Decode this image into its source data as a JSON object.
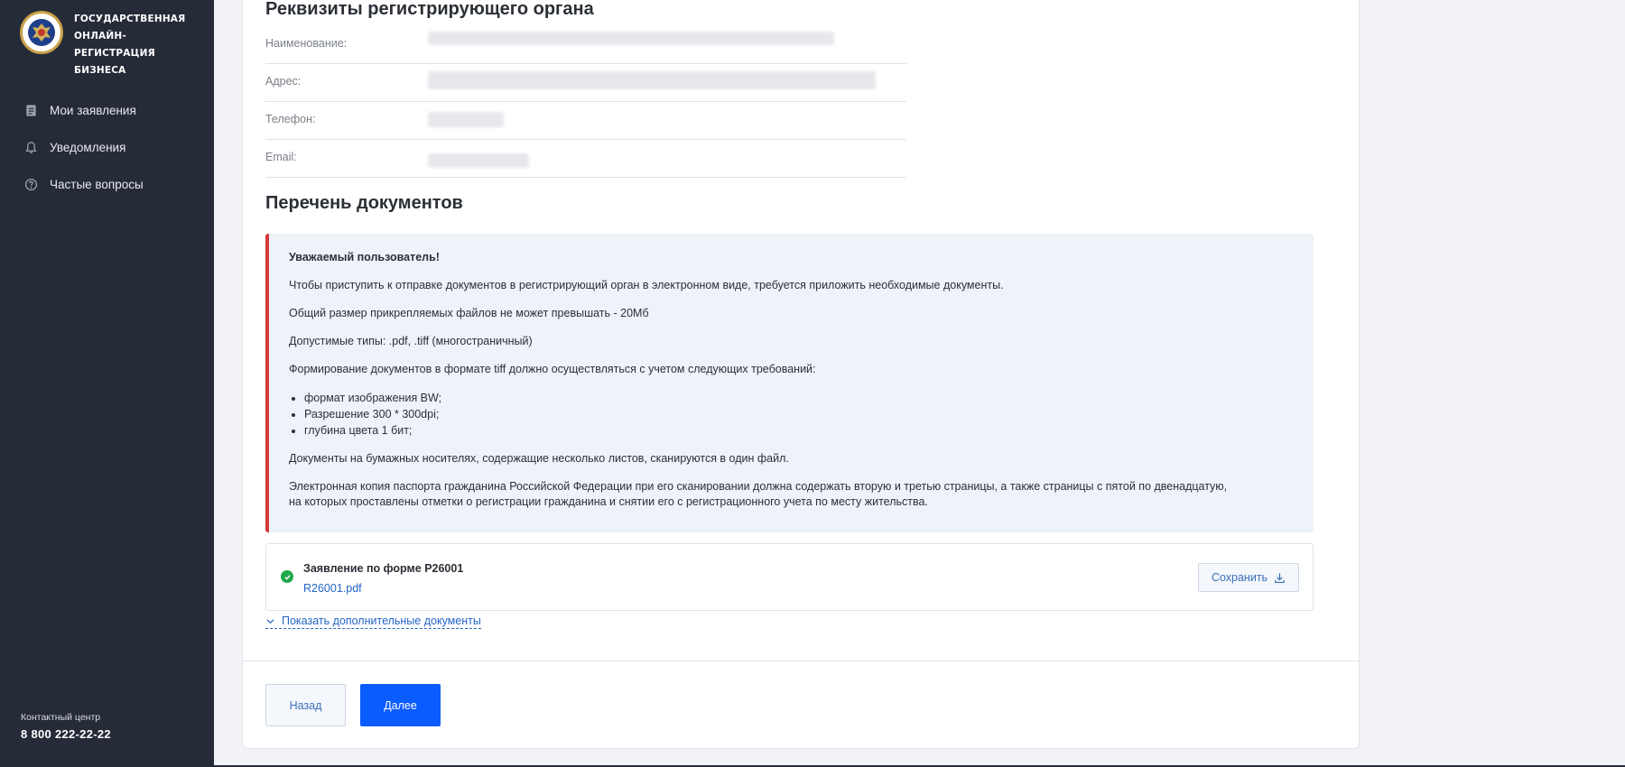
{
  "sidebar": {
    "logo_lines": [
      "ГОСУДАРСТВЕННАЯ",
      "ОНЛАЙН-РЕГИСТРАЦИЯ",
      "БИЗНЕСА"
    ],
    "nav": [
      {
        "label": "Мои заявления",
        "icon": "document-list-icon"
      },
      {
        "label": "Уведомления",
        "icon": "bell-icon"
      },
      {
        "label": "Частые вопросы",
        "icon": "question-circle-icon"
      }
    ],
    "contact_label": "Контактный центр",
    "contact_phone": "8 800 222-22-22"
  },
  "registrar": {
    "title": "Реквизиты регистрирующего органа",
    "fields": [
      {
        "label": "Наименование:",
        "value": ""
      },
      {
        "label": "Адрес:",
        "value": ""
      },
      {
        "label": "Телефон:",
        "value": ""
      },
      {
        "label": "Email:",
        "value": ""
      }
    ]
  },
  "documents": {
    "title": "Перечень документов",
    "notice": {
      "heading": "Уважаемый пользователь!",
      "p1": "Чтобы приступить к отправке документов в регистрирующий орган в электронном виде, требуется приложить необходимые документы.",
      "p2": "Общий размер прикрепляемых файлов не может превышать - 20Мб",
      "p3": "Допустимые типы: .pdf, .tiff (многостраничный)",
      "p4": "Формирование документов в формате tiff должно осуществляться с учетом следующих требований:",
      "requirements": [
        "формат изображения BW;",
        "Разрешение 300 * 300dpi;",
        "глубина цвета 1 бит;"
      ],
      "p5": "Документы на бумажных носителях, содержащие несколько листов, сканируются в один файл.",
      "p6": "Электронная копия паспорта гражданина Российской Федерации при его сканировании должна содержать вторую и третью страницы, а также страницы с пятой по двенадцатую, на которых проставлены отметки о регистрации гражданина и снятии его с регистрационного учета по месту жительства."
    },
    "item": {
      "name": "Заявление по форме Р26001",
      "file": "R26001.pdf",
      "save_label": "Сохранить",
      "status": "ok"
    },
    "more_label": "Показать дополнительные документы"
  },
  "actions": {
    "back_label": "Назад",
    "next_label": "Далее"
  },
  "colors": {
    "sidebar_bg": "#262b38",
    "primary": "#0b5cff",
    "link": "#2465c6",
    "notice_border": "#d33a3a",
    "notice_bg": "#eef2f9",
    "success": "#1fa84a"
  }
}
